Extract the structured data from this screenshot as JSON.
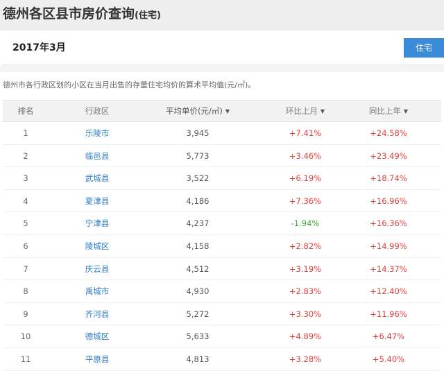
{
  "header": {
    "title": "德州各区县市房价查询",
    "title_suffix": "(住宅)"
  },
  "month_bar": {
    "month": "2017年3月",
    "type_button": "住宅"
  },
  "description": "德州市各行政区划的小区在当月出售的存量住宅均价的算术平均值(元/㎡)。",
  "table": {
    "columns": [
      {
        "label": "排名",
        "sortable": false
      },
      {
        "label": "行政区",
        "sortable": false
      },
      {
        "label": "平均单价(元/㎡)",
        "sortable": true
      },
      {
        "label": "环比上月",
        "sortable": true
      },
      {
        "label": "同比上年",
        "sortable": true
      }
    ],
    "rows": [
      {
        "rank": "1",
        "district": "乐陵市",
        "price": "3,945",
        "mom": "+7.41%",
        "yoy": "+24.58%",
        "mom_dir": "up",
        "yoy_dir": "up"
      },
      {
        "rank": "2",
        "district": "临邑县",
        "price": "5,773",
        "mom": "+3.46%",
        "yoy": "+23.49%",
        "mom_dir": "up",
        "yoy_dir": "up"
      },
      {
        "rank": "3",
        "district": "武城县",
        "price": "3,522",
        "mom": "+6.19%",
        "yoy": "+18.74%",
        "mom_dir": "up",
        "yoy_dir": "up"
      },
      {
        "rank": "4",
        "district": "夏津县",
        "price": "4,186",
        "mom": "+7.36%",
        "yoy": "+16.96%",
        "mom_dir": "up",
        "yoy_dir": "up"
      },
      {
        "rank": "5",
        "district": "宁津县",
        "price": "4,237",
        "mom": "-1.94%",
        "yoy": "+16.36%",
        "mom_dir": "down",
        "yoy_dir": "up"
      },
      {
        "rank": "6",
        "district": "陵城区",
        "price": "4,158",
        "mom": "+2.82%",
        "yoy": "+14.99%",
        "mom_dir": "up",
        "yoy_dir": "up"
      },
      {
        "rank": "7",
        "district": "庆云县",
        "price": "4,512",
        "mom": "+3.19%",
        "yoy": "+14.37%",
        "mom_dir": "up",
        "yoy_dir": "up"
      },
      {
        "rank": "8",
        "district": "禹城市",
        "price": "4,930",
        "mom": "+2.83%",
        "yoy": "+12.40%",
        "mom_dir": "up",
        "yoy_dir": "up"
      },
      {
        "rank": "9",
        "district": "齐河县",
        "price": "5,272",
        "mom": "+3.30%",
        "yoy": "+11.96%",
        "mom_dir": "up",
        "yoy_dir": "up"
      },
      {
        "rank": "10",
        "district": "德城区",
        "price": "5,633",
        "mom": "+4.89%",
        "yoy": "+6.47%",
        "mom_dir": "up",
        "yoy_dir": "up"
      },
      {
        "rank": "11",
        "district": "平原县",
        "price": "4,813",
        "mom": "+3.28%",
        "yoy": "+5.40%",
        "mom_dir": "up",
        "yoy_dir": "up"
      }
    ]
  },
  "colors": {
    "accent": "#3a8bd8",
    "link": "#2e7cc6",
    "positive": "#e0403a",
    "negative": "#3aa83a"
  },
  "icons": {
    "sort": "caret-down-icon"
  }
}
